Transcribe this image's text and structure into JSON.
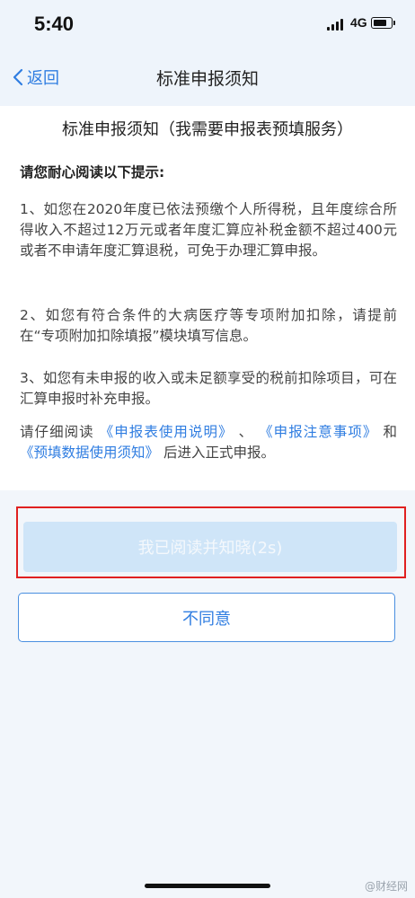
{
  "status_bar": {
    "time": "5:40",
    "network": "4G"
  },
  "nav": {
    "back_label": "返回",
    "title": "标准申报须知"
  },
  "content": {
    "heading": "标准申报须知（我需要申报表预填服务）",
    "section_heading": "请您耐心阅读以下提示:",
    "paragraphs": [
      "1、如您在2020年度已依法预缴个人所得税，且年度综合所得收入不超过12万元或者年度汇算应补税金额不超过400元或者不申请年度汇算退税，可免于办理汇算申报。",
      "2、如您有符合条件的大病医疗等专项附加扣除，请提前在“专项附加扣除填报”模块填写信息。",
      "3、如您有未申报的收入或未足额享受的税前扣除项目，可在汇算申报时补充申报。"
    ],
    "reading_note": {
      "prefix": "请仔细阅读",
      "link1": "《申报表使用说明》",
      "sep1": "、",
      "link2": "《申报注意事项》",
      "sep2": "和",
      "link3": "《预填数据使用须知》",
      "suffix": "后进入正式申报。"
    }
  },
  "actions": {
    "confirm_label": "我已阅读并知晓(2s)",
    "disagree_label": "不同意"
  },
  "watermark": "@财经网",
  "colors": {
    "accent": "#2f7de1",
    "highlight_border": "#e02020",
    "confirm_disabled_bg": "#cfe5f8"
  }
}
